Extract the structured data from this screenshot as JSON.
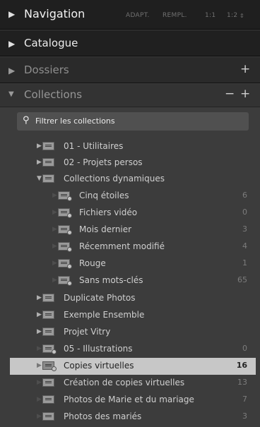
{
  "colors": {
    "selection": "#c7c7c7",
    "panel": "#3c3c3c",
    "header": "#202020"
  },
  "navigation": {
    "title": "Navigation",
    "options": [
      "ADAPT.",
      "REMPL.",
      "1:1",
      "1:2"
    ]
  },
  "catalogue": {
    "title": "Catalogue"
  },
  "dossiers": {
    "title": "Dossiers",
    "add": "+"
  },
  "collections": {
    "title": "Collections",
    "remove": "−",
    "add": "+",
    "filter_label": "Filtrer les collections",
    "items": [
      {
        "label": "01 - Utilitaires",
        "icon": "collection-set-icon",
        "expander": "collapsed"
      },
      {
        "label": "02 - Projets persos",
        "icon": "collection-set-icon",
        "expander": "collapsed"
      },
      {
        "label": "Collections dynamiques",
        "icon": "collection-set-icon",
        "expander": "expanded"
      },
      {
        "label": "Cinq étoiles",
        "count": "6",
        "icon": "smart-collection-icon"
      },
      {
        "label": "Fichiers vidéo",
        "count": "0",
        "icon": "smart-collection-icon"
      },
      {
        "label": "Mois dernier",
        "count": "3",
        "icon": "smart-collection-icon"
      },
      {
        "label": "Récemment modifié",
        "count": "4",
        "icon": "smart-collection-icon"
      },
      {
        "label": "Rouge",
        "count": "1",
        "icon": "smart-collection-icon"
      },
      {
        "label": "Sans mots-clés",
        "count": "65",
        "icon": "smart-collection-icon"
      },
      {
        "label": "Duplicate Photos",
        "icon": "collection-set-icon",
        "expander": "collapsed"
      },
      {
        "label": "Exemple Ensemble",
        "icon": "collection-set-icon",
        "expander": "collapsed"
      },
      {
        "label": "Projet Vitry",
        "icon": "collection-set-icon",
        "expander": "collapsed"
      },
      {
        "label": "05 - Illustrations",
        "count": "0",
        "icon": "smart-collection-icon"
      },
      {
        "label": "Copies virtuelles",
        "count": "16",
        "icon": "smart-collection-icon",
        "selected": true
      },
      {
        "label": "Création de copies virtuelles",
        "count": "13",
        "icon": "collection-icon"
      },
      {
        "label": "Photos de Marie et du mariage",
        "count": "7",
        "icon": "collection-icon"
      },
      {
        "label": "Photos des mariés",
        "count": "3",
        "icon": "collection-icon"
      }
    ]
  }
}
